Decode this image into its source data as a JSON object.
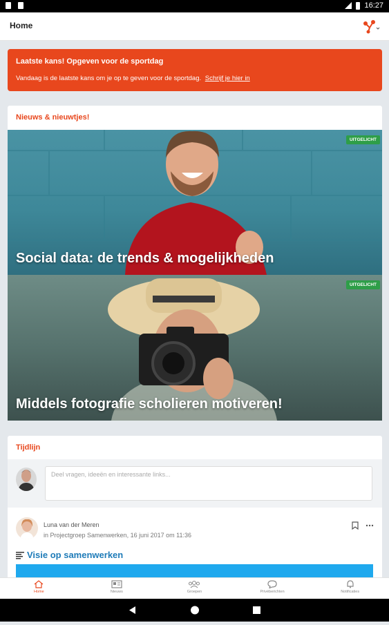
{
  "status_bar": {
    "time": "16:27"
  },
  "app_bar": {
    "title": "Home",
    "logo_icon": "network-logo-icon"
  },
  "banner": {
    "title": "Laatste kans! Opgeven voor de sportdag",
    "body": "Vandaag is de laatste kans om je op te geven voor de sportdag.",
    "link": "Schrijf je hier in",
    "color": "#e8471d"
  },
  "news": {
    "title": "Nieuws & nieuwtjes!",
    "articles": [
      {
        "badge": "UITGELICHT",
        "title": "Social data: de trends & mogelijkheden"
      },
      {
        "badge": "UITGELICHT",
        "title": "Middels fotografie scholieren motiveren!"
      }
    ]
  },
  "timeline": {
    "title": "Tijdlijn",
    "compose_placeholder": "Deel vragen, ideeën en interessante links...",
    "post": {
      "author": "Luna van der Meren",
      "meta": "in Projectgroep Samenwerken, 16 juni 2017 om 11:36",
      "title": "Visie op samenwerken"
    }
  },
  "bottom_nav": {
    "items": [
      {
        "label": "Home",
        "icon": "home-icon"
      },
      {
        "label": "Nieuws",
        "icon": "news-icon"
      },
      {
        "label": "Groepen",
        "icon": "groups-icon"
      },
      {
        "label": "Privéberichten",
        "icon": "chat-icon"
      },
      {
        "label": "Notificaties",
        "icon": "bell-icon"
      }
    ]
  }
}
